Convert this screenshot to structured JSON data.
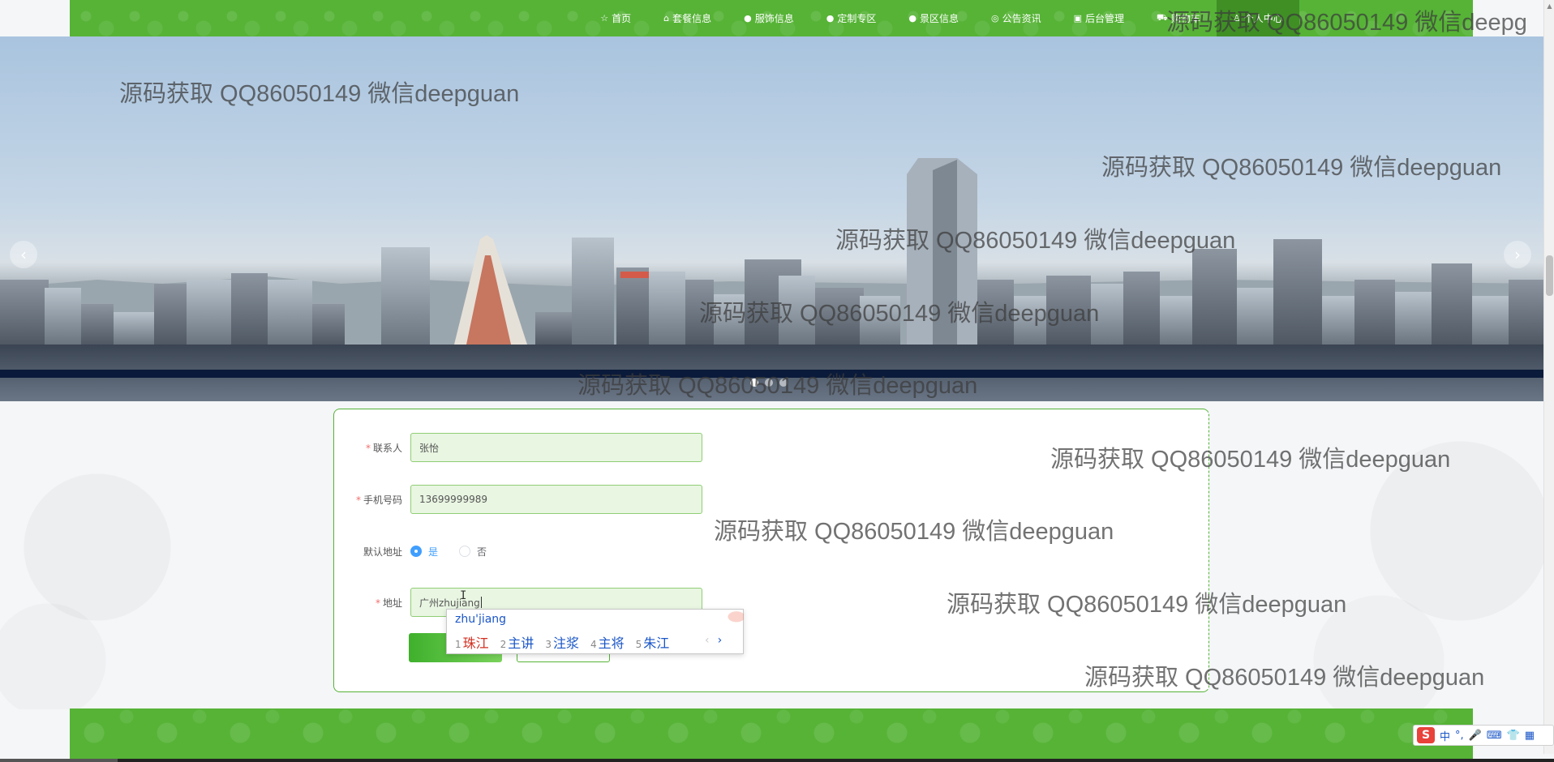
{
  "nav": {
    "items": [
      {
        "icon": "star-icon",
        "glyph": "☆",
        "label": "首页"
      },
      {
        "icon": "home-icon",
        "glyph": "⌂",
        "label": "套餐信息"
      },
      {
        "icon": "info-icon",
        "glyph": "●",
        "label": "服饰信息"
      },
      {
        "icon": "info-icon",
        "glyph": "●",
        "label": "定制专区"
      },
      {
        "icon": "info-icon",
        "glyph": "●",
        "label": "景区信息"
      },
      {
        "icon": "globe-icon",
        "glyph": "◎",
        "label": "公告资讯"
      },
      {
        "icon": "box-icon",
        "glyph": "▣",
        "label": "后台管理"
      },
      {
        "icon": "cart-icon",
        "glyph": "⛟",
        "label": "购物车"
      },
      {
        "icon": "user-icon",
        "glyph": "♙",
        "label": "个人中心"
      }
    ],
    "active_index": 8
  },
  "banner": {
    "dots": 3,
    "active_dot": 0
  },
  "form": {
    "contact_label": "联系人",
    "contact_value": "张怡",
    "phone_label": "手机号码",
    "phone_value": "13699999989",
    "default_label": "默认地址",
    "default_yes": "是",
    "default_no": "否",
    "default_selected": "是",
    "address_label": "地址",
    "address_value": "广州zhujiang"
  },
  "ime": {
    "pinyin": "zhu'jiang",
    "candidates": [
      {
        "num": "1",
        "text": "珠江"
      },
      {
        "num": "2",
        "text": "主讲"
      },
      {
        "num": "3",
        "text": "注浆"
      },
      {
        "num": "4",
        "text": "主将"
      },
      {
        "num": "5",
        "text": "朱江"
      }
    ],
    "prev": "‹",
    "next": "›"
  },
  "tray": {
    "logo": "S",
    "mode": "中",
    "punct": "°,",
    "mic": "🎤",
    "keyboard": "⌨",
    "shirt": "👕",
    "grid": "▦"
  },
  "watermarks": [
    "源码获取 QQ86050149 微信deepguan",
    "源码获取 QQ86050149 微信deepguan",
    "源码获取 QQ86050149 微信deepguan",
    "源码获取 QQ86050149 微信deepguan",
    "源码获取 QQ86050149 微信deepguan",
    "源码获取 QQ86050149 微信deepguan",
    "源码获取 QQ86050149 微信deepguan",
    "源码获取 QQ86050149 微信deepguan",
    "源码获取 QQ86050149 微信deepguan",
    "源码获取 QQ86050149 微信deepg"
  ],
  "colors": {
    "brand_green": "#56b336",
    "active_nav": "#3f8f25",
    "required": "#f56c6c",
    "radio_checked": "#409eff"
  }
}
